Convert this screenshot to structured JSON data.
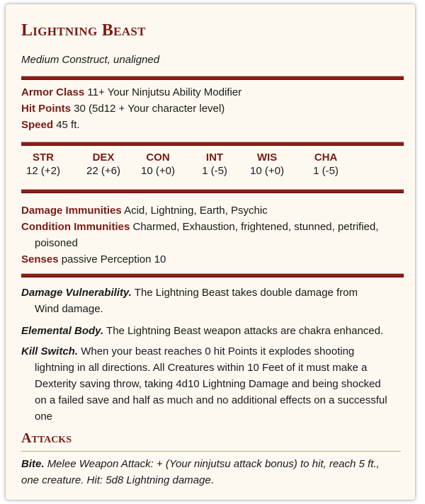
{
  "title": "Lightning Beast",
  "subtitle": "Medium Construct, unaligned",
  "stats": {
    "armor_class_label": "Armor Class",
    "armor_class_value": "11+ Your Ninjutsu Ability Modifier",
    "hit_points_label": "Hit Points",
    "hit_points_value": "30 (5d12 + Your character level)",
    "speed_label": "Speed",
    "speed_value": "45 ft."
  },
  "abilities": [
    {
      "name": "STR",
      "value": "12 (+2)"
    },
    {
      "name": "DEX",
      "value": "22 (+6)"
    },
    {
      "name": "CON",
      "value": "10 (+0)"
    },
    {
      "name": "INT",
      "value": "1 (-5)"
    },
    {
      "name": "WIS",
      "value": "10 (+0)"
    },
    {
      "name": "CHA",
      "value": "1 (-5)"
    }
  ],
  "details": {
    "damage_immunities_label": "Damage Immunities",
    "damage_immunities_value": "Acid, Lightning, Earth, Psychic",
    "condition_immunities_label": "Condition Immunities",
    "condition_immunities_value_1": "Charmed, Exhaustion, frightened, stunned, petrified,",
    "condition_immunities_value_2": "poisoned",
    "senses_label": "Senses",
    "senses_value": "passive Perception 10"
  },
  "traits": {
    "vulnerability_name": "Damage Vulnerability.",
    "vulnerability_text_1": "The Lightning Beast takes double damage from",
    "vulnerability_text_2": "Wind damage.",
    "elemental_name": "Elemental Body.",
    "elemental_text": "The Lightning Beast weapon attacks are chakra enhanced.",
    "kill_name": "Kill Switch.",
    "kill_text_1": "When your beast reaches 0 hit Points it explodes shooting",
    "kill_text_2": "lightning in all directions. All Creatures within 10 Feet of it must make a",
    "kill_text_3": "Dexterity saving throw, taking 4d10 Lightning Damage and being shocked",
    "kill_text_4": "on a failed save and half as much and no additional effects on a successful",
    "kill_text_5": "one"
  },
  "attacks": {
    "section_title": "Attacks",
    "bite_name": "Bite.",
    "bite_text_1": "Melee Weapon Attack: + (Your ninjutsu attack bonus) to hit, reach 5 ft.,",
    "bite_text_2": "one creature. Hit: 5d8 Lightning damage",
    "bite_text_2_end": "."
  }
}
